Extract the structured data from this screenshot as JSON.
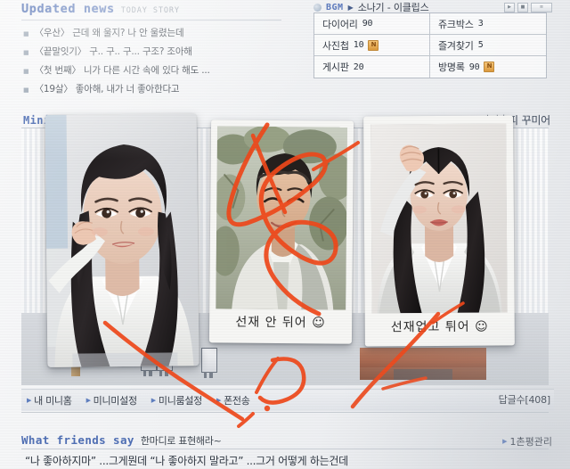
{
  "news": {
    "title": "Updated news",
    "subtitle": "TODAY STORY",
    "items": [
      "〈우산〉 근데 왜 울지? 나 안 울렸는데",
      "〈끝말잇기〉 구.. 구.. 구... 구조? 조아해",
      "〈첫 번째〉 니가 다른 시간 속에 있다 해도 ...",
      "〈19살〉 좋아해, 내가 너 좋아한다고"
    ]
  },
  "bgm": {
    "label": "BGM",
    "play_icon": "▶",
    "track": "소나기 - 이클립스",
    "controls": [
      "▶",
      "■",
      "≡"
    ]
  },
  "menu": {
    "cells": [
      {
        "label": "다이어리",
        "count": "90",
        "badge": ""
      },
      {
        "label": "쥬크박스",
        "count": "3",
        "badge": ""
      },
      {
        "label": "사진첩",
        "count": "10",
        "badge": "N"
      },
      {
        "label": "즐겨찾기",
        "count": "5",
        "badge": ""
      },
      {
        "label": "게시판",
        "count": "20",
        "badge": ""
      },
      {
        "label": "방명록",
        "count": "90",
        "badge": "N"
      }
    ]
  },
  "hompy": {
    "title": "Mini room",
    "right_label": "미니홈피 꾸미어"
  },
  "bottom_nav": {
    "links": [
      "내 미니홈",
      "미니미설정",
      "미니룸설정",
      "폰전송"
    ],
    "arrow": "▶",
    "reply_count": "답글수[408]"
  },
  "friends": {
    "title": "What friends say",
    "subtitle": "한마디로 표현해라~",
    "manage_link": "1촌평관리",
    "arrow": "▶",
    "quote": "“나 좋아하지마” ...그게뭔데 “나 좋아하지 말라고” ...그거 어떻게 하는건데"
  },
  "photocards": [
    {
      "caption": "",
      "subject": "young-woman-white-shirt-hand-in-hair"
    },
    {
      "caption": "선재 안 뒤어 ☺",
      "subject": "young-man-outdoors-smiling"
    },
    {
      "caption": "선재업고 튀어 ☺",
      "subject": "young-woman-white-blouse-hand-raised"
    }
  ],
  "annotation": {
    "marker_color": "#f04a18",
    "description": "orange marker scribbles over middle photocard and across screen"
  },
  "colors": {
    "header_blue": "#4f6fb5",
    "screen_bg": "#f2f3f5",
    "badge_orange": "#dd9b3d",
    "room_blue": "#5b92d6",
    "shelf_brown": "#a96a52"
  }
}
